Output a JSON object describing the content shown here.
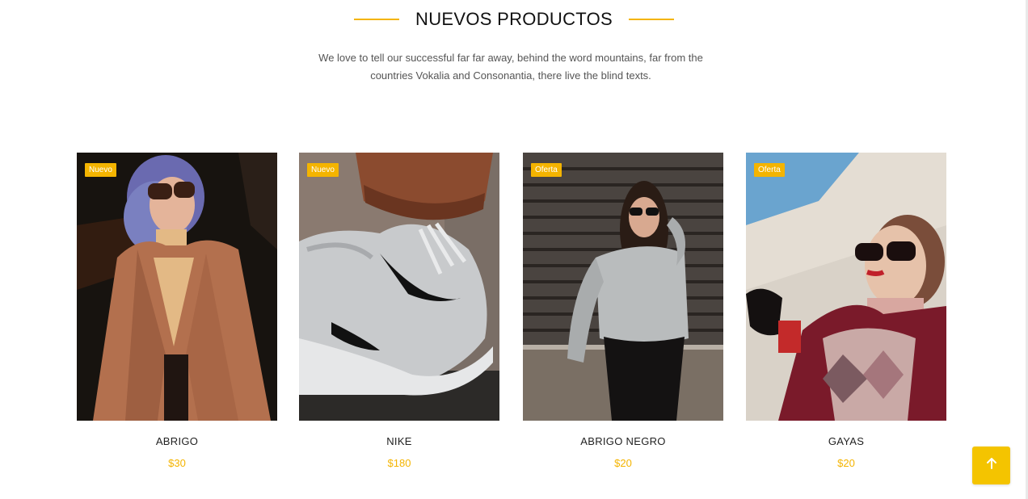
{
  "section": {
    "title": "NUEVOS PRODUCTOS",
    "subtitle_line1": "We love to tell our successful far far away, behind the word mountains, far from the",
    "subtitle_line2": "countries Vokalia and Consonantia, there live the blind texts."
  },
  "products": [
    {
      "badge": "Nuevo",
      "name": "ABRIGO",
      "price": "$30",
      "image": "woman-in-brown-coat"
    },
    {
      "badge": "Nuevo",
      "name": "NIKE",
      "price": "$180",
      "image": "grey-nike-sneaker"
    },
    {
      "badge": "Oferta",
      "name": "ABRIGO NEGRO",
      "price": "$20",
      "image": "woman-in-grey-sweater"
    },
    {
      "badge": "Oferta",
      "name": "GAYAS",
      "price": "$20",
      "image": "woman-with-sunglasses"
    }
  ],
  "scroll_top": {
    "icon": "arrow-up-icon"
  },
  "colors": {
    "accent": "#f4b400",
    "button": "#f4c400",
    "heading_text": "#111111",
    "body_text": "#555555"
  }
}
